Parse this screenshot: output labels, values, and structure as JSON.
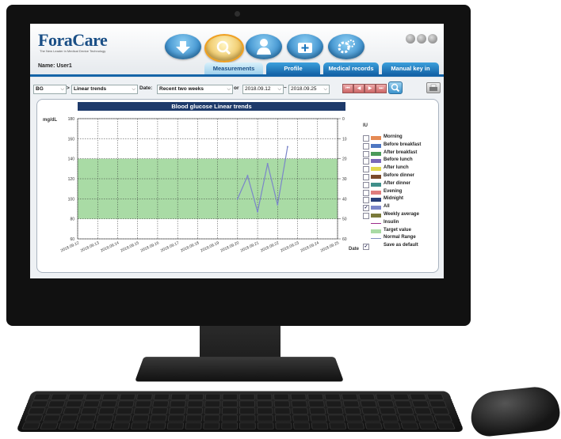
{
  "app": {
    "logo_text": "ForaCare",
    "logo_tagline": "The New Leader in Medical Device Technology",
    "name_label": "Name:  User1"
  },
  "nav_icons": [
    "download-icon",
    "search-icon",
    "doctor-icon",
    "medical-kit-icon",
    "settings-gears-icon"
  ],
  "tabs": [
    "Measurements",
    "Profile",
    "Medical records",
    "Manual key in"
  ],
  "toolbar": {
    "type_select": "BG",
    "arrow_sep": ">",
    "view_select": "Linear trends",
    "date_label": "Date:",
    "range_select": "Recent two weeks",
    "or_label": "or",
    "start_date": "2018.09.12",
    "tilde": "~",
    "end_date": "2018.09.25"
  },
  "chart_data": {
    "type": "line",
    "title": "Blood glucose Linear trends",
    "ylabel": "mg/dL",
    "y2label": "IU",
    "xlabel": "Date",
    "ylim": [
      60,
      180
    ],
    "yticks": [
      60,
      80,
      100,
      120,
      140,
      160,
      180
    ],
    "y2ticks": [
      "0",
      "10",
      "20",
      "30",
      "40",
      "50",
      "60"
    ],
    "categories": [
      "2018.09.12",
      "2018.09.13",
      "2018.09.14",
      "2018.09.15",
      "2018.09.16",
      "2018.09.17",
      "2018.09.18",
      "2018.09.19",
      "2018.09.20",
      "2018.09.21",
      "2018.09.22",
      "2018.09.23",
      "2018.09.24",
      "2018.09.25"
    ],
    "target_range": [
      80,
      140
    ],
    "series": [
      {
        "name": "All",
        "color": "#7b86c9",
        "points": [
          {
            "x": 8.0,
            "y": 100
          },
          {
            "x": 8.5,
            "y": 123
          },
          {
            "x": 9.0,
            "y": 87
          },
          {
            "x": 9.5,
            "y": 135
          },
          {
            "x": 10.0,
            "y": 94
          },
          {
            "x": 10.5,
            "y": 152
          }
        ]
      }
    ],
    "grid": true
  },
  "legend": [
    {
      "label": "Morning",
      "kind": "swatch",
      "color": "#e58a54",
      "checked": false
    },
    {
      "label": "Before breakfast",
      "kind": "swatch",
      "color": "#4e77c2",
      "checked": false
    },
    {
      "label": "After breakfast",
      "kind": "swatch",
      "color": "#4a9a5a",
      "checked": false
    },
    {
      "label": "Before lunch",
      "kind": "swatch",
      "color": "#7a68b8",
      "checked": false
    },
    {
      "label": "After lunch",
      "kind": "swatch",
      "color": "#e2d84c",
      "checked": false
    },
    {
      "label": "Before dinner",
      "kind": "swatch",
      "color": "#7a4a2a",
      "checked": false
    },
    {
      "label": "After dinner",
      "kind": "swatch",
      "color": "#3f8f8a",
      "checked": false
    },
    {
      "label": "Evening",
      "kind": "swatch",
      "color": "#e07d7d",
      "checked": false
    },
    {
      "label": "Midnight",
      "kind": "swatch",
      "color": "#2a3f7a",
      "checked": false
    },
    {
      "label": "All",
      "kind": "swatch",
      "color": "#7b86c9",
      "checked": true
    },
    {
      "label": "Weekly average",
      "kind": "swatch",
      "color": "#7a7a3a",
      "checked": false
    },
    {
      "label": "Insulin",
      "kind": "line",
      "color": "#9c2b8a",
      "checked": null
    },
    {
      "label": "Target value",
      "kind": "swatch",
      "color": "#a9dba5",
      "checked": null
    },
    {
      "label": "Normal Range",
      "kind": "line",
      "color": "#7f8fbf",
      "checked": null
    },
    {
      "label": "Save as default",
      "kind": "none",
      "color": "",
      "checked": true
    }
  ],
  "colors": {
    "brand_blue": "#1565a8",
    "chart_title_bg": "#1e3a6a",
    "target_fill": "#a9dba5"
  }
}
